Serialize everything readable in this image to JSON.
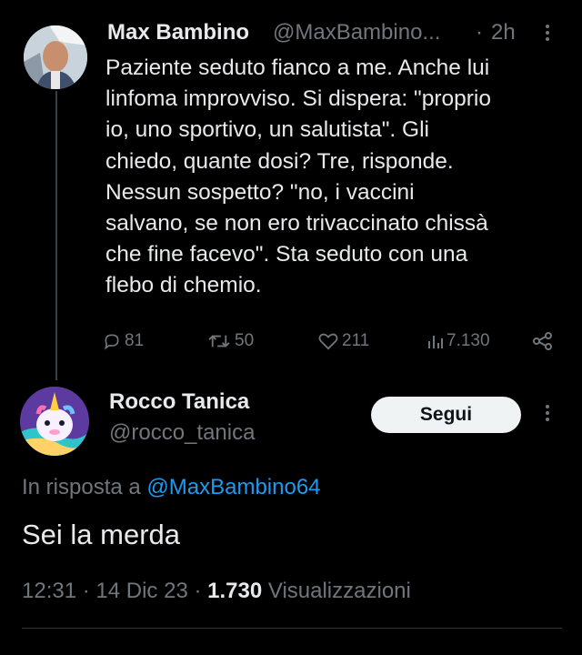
{
  "tweet": {
    "author_name": "Max Bambino",
    "author_handle": "@MaxBambino...",
    "separator": "·",
    "time": "2h",
    "text_lines": [
      "Paziente seduto fianco a me. Anche lui",
      "linfoma improvviso. Si dispera: \"proprio",
      "io, uno sportivo, un salutista\". Gli",
      "chiedo, quante dosi? Tre, risponde.",
      "Nessun sospetto? \"no, i vaccini",
      "salvano,  se non ero trivaccinato chissà",
      "che fine facevo\". Sta seduto con una",
      "flebo di chemio."
    ],
    "stats": {
      "replies": "81",
      "retweets": "50",
      "likes": "211",
      "views": "7.130"
    }
  },
  "reply": {
    "author_name": "Rocco Tanica",
    "author_handle": "@rocco_tanica",
    "follow_label": "Segui",
    "replying_prefix": "In risposta a",
    "replying_to": "@MaxBambino64",
    "text": "Sei la merda",
    "time": "12:31",
    "date": "14 Dic 23",
    "dot": "·",
    "views_count": "1.730",
    "views_label": "Visualizzazioni"
  },
  "colors": {
    "link": "#1d9bf0",
    "muted": "#71767b",
    "text": "#e7e9ea",
    "background": "#000000"
  }
}
